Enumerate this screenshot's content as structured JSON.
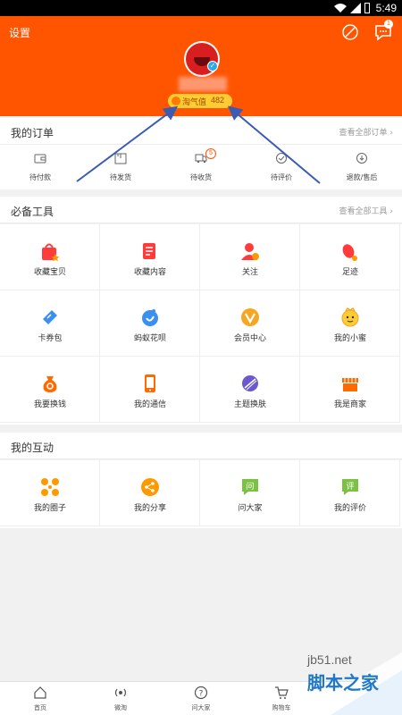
{
  "status_bar": {
    "time": "5:49"
  },
  "header": {
    "settings_label": "设置",
    "points_label": "淘气值",
    "points_value": "482",
    "message_count": "1"
  },
  "orders": {
    "title": "我的订单",
    "more": "查看全部订单",
    "items": [
      {
        "label": "待付款",
        "icon": "wallet-icon"
      },
      {
        "label": "待发货",
        "icon": "box-icon"
      },
      {
        "label": "待收货",
        "icon": "truck-icon",
        "badge": "5"
      },
      {
        "label": "待评价",
        "icon": "review-icon"
      },
      {
        "label": "退款/售后",
        "icon": "refund-icon"
      }
    ]
  },
  "tools": {
    "title": "必备工具",
    "more": "查看全部工具",
    "items": [
      {
        "label": "收藏宝贝",
        "icon": "favorite-bag-icon"
      },
      {
        "label": "收藏内容",
        "icon": "favorite-content-icon"
      },
      {
        "label": "关注",
        "icon": "follow-icon"
      },
      {
        "label": "足迹",
        "icon": "footprint-icon"
      },
      {
        "label": "卡券包",
        "icon": "coupon-icon"
      },
      {
        "label": "蚂蚁花呗",
        "icon": "huabei-icon"
      },
      {
        "label": "会员中心",
        "icon": "vip-icon"
      },
      {
        "label": "我的小蜜",
        "icon": "assistant-icon"
      },
      {
        "label": "我要换钱",
        "icon": "money-bag-icon"
      },
      {
        "label": "我的通信",
        "icon": "phone-icon"
      },
      {
        "label": "主题换肤",
        "icon": "theme-icon"
      },
      {
        "label": "我是商家",
        "icon": "shop-icon"
      }
    ]
  },
  "interaction": {
    "title": "我的互动",
    "items": [
      {
        "label": "我的圈子",
        "icon": "circle-icon"
      },
      {
        "label": "我的分享",
        "icon": "share-icon"
      },
      {
        "label": "问大家",
        "icon": "ask-icon"
      },
      {
        "label": "我的评价",
        "icon": "evaluate-icon"
      }
    ]
  },
  "bottom_nav": [
    {
      "label": "首页",
      "icon": "home-icon"
    },
    {
      "label": "微淘",
      "icon": "weitao-icon"
    },
    {
      "label": "问大家",
      "icon": "question-icon"
    },
    {
      "label": "购物车",
      "icon": "cart-icon"
    }
  ],
  "watermark": {
    "url": "jb51.net",
    "name": "脚本之家"
  },
  "colors": {
    "brand": "#ff5500",
    "arrow": "#3b5bb5"
  }
}
